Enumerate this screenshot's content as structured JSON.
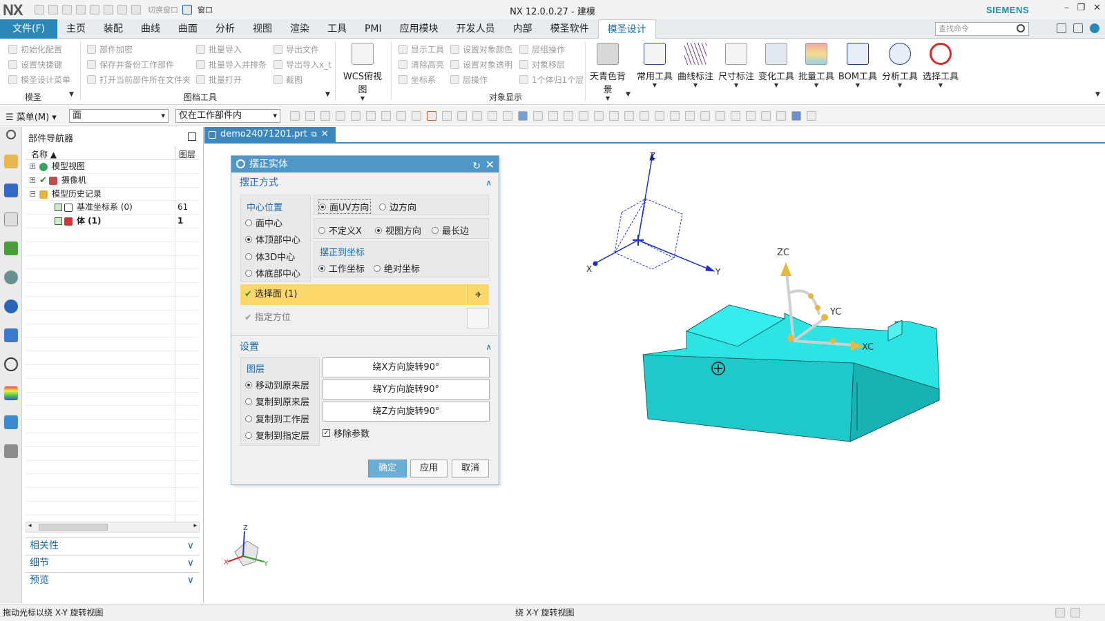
{
  "app": {
    "logo": "NX",
    "title": "NX 12.0.0.27 - 建模",
    "brand": "SIEMENS",
    "quick_access": {
      "switch_window": "切换窗口",
      "window": "窗口"
    }
  },
  "menubar": {
    "tabs": [
      "文件(F)",
      "主页",
      "装配",
      "曲线",
      "曲面",
      "分析",
      "视图",
      "渲染",
      "工具",
      "PMI",
      "应用模块",
      "开发人员",
      "内部",
      "模圣软件",
      "模圣设计"
    ],
    "active_tab": "模圣设计",
    "search_placeholder": "查找命令"
  },
  "ribbon": {
    "group1": {
      "items": [
        "初始化配置",
        "设置快捷键",
        "模圣设计菜单"
      ],
      "label": "模圣"
    },
    "group2": {
      "items": [
        "部件加密",
        "保存并备份工作部件",
        "打开当前部件所在文件夹"
      ]
    },
    "group3": {
      "items": [
        "批量导入",
        "批量导入并排条",
        "批量打开"
      ],
      "label": "图档工具"
    },
    "group4": {
      "items": [
        "导出文件",
        "导出导入x_t",
        "截图"
      ]
    },
    "wcs": {
      "label": "WCS俯视图"
    },
    "group5": {
      "items": [
        "显示工具",
        "清除高亮",
        "坐标系"
      ]
    },
    "group6": {
      "items": [
        "设置对象颜色",
        "设置对象透明",
        "层操作"
      ],
      "label": "对象显示"
    },
    "group7": {
      "items": [
        "层组操作",
        "对象移层",
        "1个体归1个层"
      ]
    },
    "big_buttons": [
      "天青色背景",
      "常用工具",
      "曲线标注",
      "尺寸标注",
      "变化工具",
      "批量工具",
      "BOM工具",
      "分析工具",
      "选择工具"
    ]
  },
  "toolbar2": {
    "menu": "菜单(M)",
    "filter_value": "面",
    "scope_value": "仅在工作部件内"
  },
  "navigator": {
    "title": "部件导航器",
    "col_name": "名称",
    "col_layer": "图层",
    "rows": [
      {
        "label": "模型视图",
        "layer": ""
      },
      {
        "label": "摄像机",
        "layer": ""
      },
      {
        "label": "模型历史记录",
        "layer": ""
      },
      {
        "label": "基准坐标系 (0)",
        "layer": "61"
      },
      {
        "label": "体 (1)",
        "layer": "1"
      }
    ],
    "sections": [
      "相关性",
      "细节",
      "预览"
    ]
  },
  "doc_tab": "demo24071201.prt",
  "dialog": {
    "title": "摆正实体",
    "section1": "摆正方式",
    "center_label": "中心位置",
    "center_options": [
      "面中心",
      "体顶部中心",
      "体3D中心",
      "体底部中心"
    ],
    "center_selected": 1,
    "dir_options": [
      "面UV方向",
      "边方向"
    ],
    "dir_selected": 0,
    "axis_options": [
      "不定义X",
      "视图方向",
      "最长边"
    ],
    "axis_selected": 1,
    "coord_label": "摆正到坐标",
    "coord_options": [
      "工作坐标",
      "绝对坐标"
    ],
    "coord_selected": 0,
    "select_face": "选择面 (1)",
    "orient": "指定方位",
    "section2": "设置",
    "layer_label": "图层",
    "layer_options": [
      "移动到原来层",
      "复制到原来层",
      "复制到工作层",
      "复制到指定层"
    ],
    "layer_selected": 0,
    "rotate_buttons": [
      "绕X方向旋转90°",
      "绕Y方向旋转90°",
      "绕Z方向旋转90°"
    ],
    "remove_params": "移除参数",
    "remove_params_checked": true,
    "ok": "确定",
    "apply": "应用",
    "cancel": "取消"
  },
  "viewport": {
    "axis_labels": {
      "z": "Z",
      "x": "X",
      "y": "Y",
      "zc": "ZC",
      "yc": "YC",
      "xc": "XC"
    },
    "solid_color": "#19dcdc"
  },
  "status": {
    "left": "拖动光标以绕 X-Y 旋转视图",
    "center": "绕 X-Y 旋转视图"
  }
}
